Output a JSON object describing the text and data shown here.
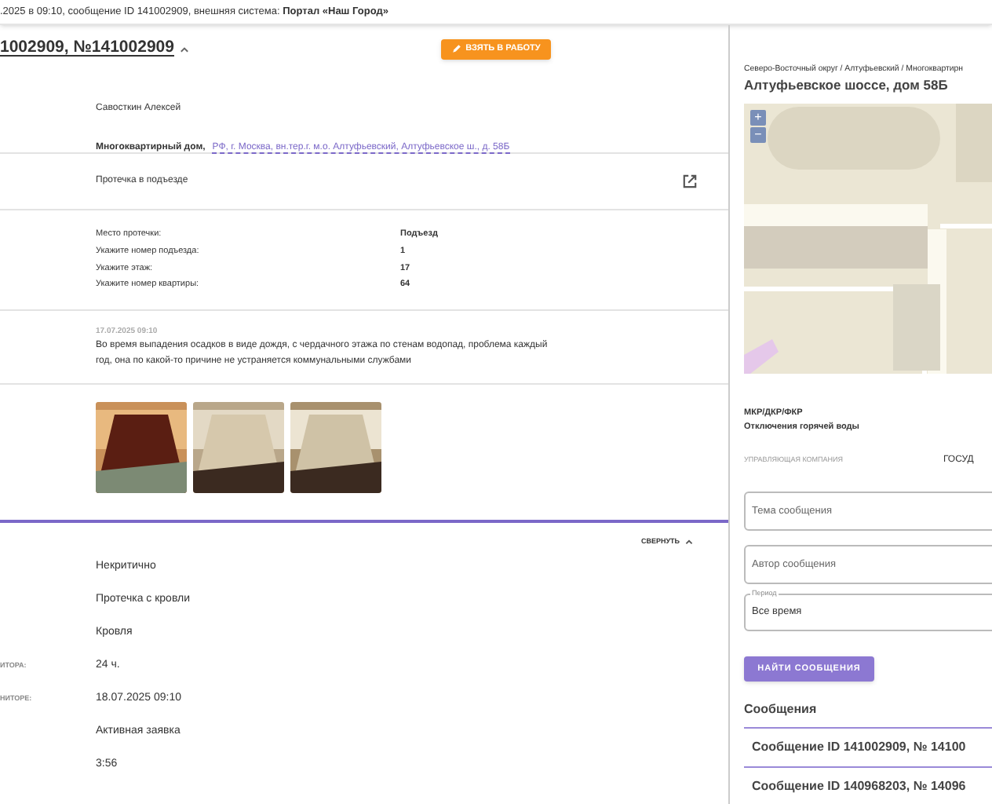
{
  "top_bar": {
    "text": ".2025 в 09:10, сообщение ID 141002909, внешняя система: **Портал «Наш Город»**"
  },
  "request": {
    "title": "1002909, №141002909",
    "expanded": true,
    "action_button": "ВЗЯТЬ В РАБОТУ",
    "author": "Савосткин Алексей",
    "address_label": "Многоквартирный дом,",
    "address_link": "РФ, г. Москва, вн.тер.г. м.о. Алтуфьевский, Алтуфьевское ш., д. 58Б",
    "category": "Протечка в подъезде",
    "fields": [
      {
        "label": "Место протечки:",
        "value": "Подъезд"
      },
      {
        "label": "Укажите номер подъезда:",
        "value": "1"
      },
      {
        "label": "Укажите этаж:",
        "value": "17"
      },
      {
        "label": "Укажите номер квартиры:",
        "value": "64"
      }
    ],
    "message_date": "17.07.2025 09:10",
    "message_text": "Во время выпадения осадков в виде дождя, с чердачного этажа по стенам водопад, проблема каждый год, она по какой-то причине не устраняется коммунальными службами"
  },
  "details": {
    "collapse_label": "СВЕРНУТЬ",
    "expanded": true,
    "rows": [
      {
        "value": "Некритично"
      },
      {
        "value": "Протечка с кровли"
      },
      {
        "value": "Кровля"
      },
      {
        "label": "ИТОРА:",
        "value": "24 ч."
      },
      {
        "label": "НИТОРЕ:",
        "value": "18.07.2025 09:10"
      },
      {
        "value": "Активная заявка"
      },
      {
        "value": "3:56"
      }
    ]
  },
  "sidebar": {
    "breadcrumb": "Северо-Восточный округ / Алтуфьевский / Многоквартирн",
    "heading": "Алтуфьевское шоссе, дом 58Б",
    "map": {
      "zoom_in": "+",
      "zoom_out": "−"
    },
    "program": "МКР/ДКР/ФКР",
    "outage": "Отключения горячей воды",
    "company_label": "УПРАВЛЯЮЩАЯ КОМПАНИЯ",
    "company_value": "ГОСУД",
    "filters": [
      {
        "placeholder": "Тема сообщения"
      },
      {
        "placeholder": "Автор сообщения"
      },
      {
        "label": "Период",
        "value": "Все время"
      }
    ],
    "search_button": "НАЙТИ СООБЩЕНИЯ",
    "messages_title": "Сообщения",
    "messages": [
      {
        "title": "Сообщение ID 141002909, № 14100"
      },
      {
        "title": "Сообщение ID 140968203, № 14096"
      }
    ]
  }
}
